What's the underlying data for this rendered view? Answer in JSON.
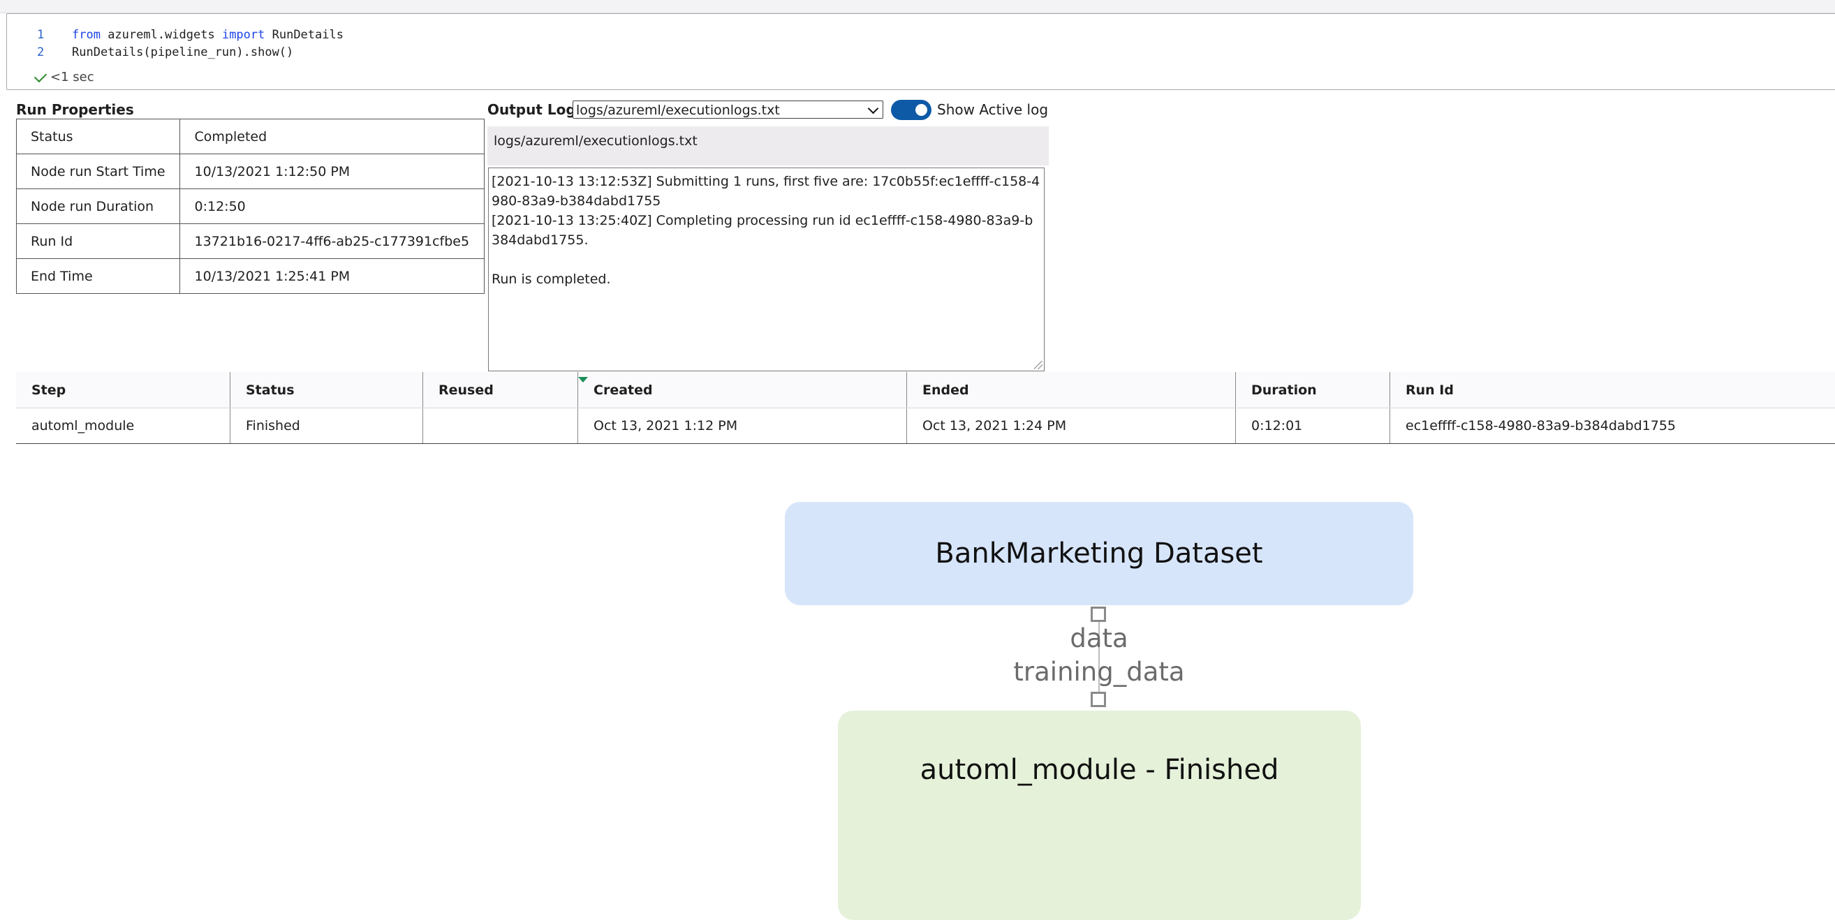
{
  "code_cell": {
    "lines": [
      {
        "num": "1",
        "kw1": "from",
        "mid": " azureml.widgets ",
        "kw2": "import",
        "rest": " RunDetails"
      },
      {
        "num": "2",
        "text": "RunDetails(pipeline_run).show()"
      }
    ],
    "exec_time": "<1 sec"
  },
  "run_properties": {
    "title": "Run Properties",
    "rows": [
      {
        "key": "Status",
        "value": "Completed"
      },
      {
        "key": "Node run Start Time",
        "value": "10/13/2021 1:12:50 PM"
      },
      {
        "key": "Node run Duration",
        "value": "0:12:50"
      },
      {
        "key": "Run Id",
        "value": "13721b16-0217-4ff6-ab25-c177391cfbe5"
      },
      {
        "key": "End Time",
        "value": "10/13/2021 1:25:41 PM"
      }
    ]
  },
  "output_logs": {
    "title": "Output Logs",
    "selected_file": "logs/azureml/executionlogs.txt",
    "toggle_label": "Show Active log",
    "toggle_on": true,
    "file_header": "logs/azureml/executionlogs.txt",
    "log_lines": [
      "[2021-10-13 13:12:53Z] Submitting 1 runs, first five are: 17c0b55f:ec1effff-c158-4980-83a9-b384dabd1755",
      "[2021-10-13 13:25:40Z] Completing processing run id ec1effff-c158-4980-83a9-b384dabd1755.",
      "",
      "Run is completed."
    ]
  },
  "steps_table": {
    "headers": [
      "Step",
      "Status",
      "Reused",
      "Created",
      "Ended",
      "Duration",
      "Run Id"
    ],
    "sorted_column": "Created",
    "rows": [
      [
        "automl_module",
        "Finished",
        "",
        "Oct 13, 2021 1:12 PM",
        "Oct 13, 2021 1:24 PM",
        "0:12:01",
        "ec1effff-c158-4980-83a9-b384dabd1755"
      ]
    ]
  },
  "graph": {
    "dataset_node": "BankMarketing Dataset",
    "edge_output": "data",
    "edge_input": "training_data",
    "module_node": "automl_module - Finished",
    "colors": {
      "dataset": "#d7e5fb",
      "module": "#e5f1d9"
    }
  },
  "colors": {
    "accent": "#0e5aa7",
    "keyword": "#1d44e8",
    "line_number": "#2a63c9"
  }
}
